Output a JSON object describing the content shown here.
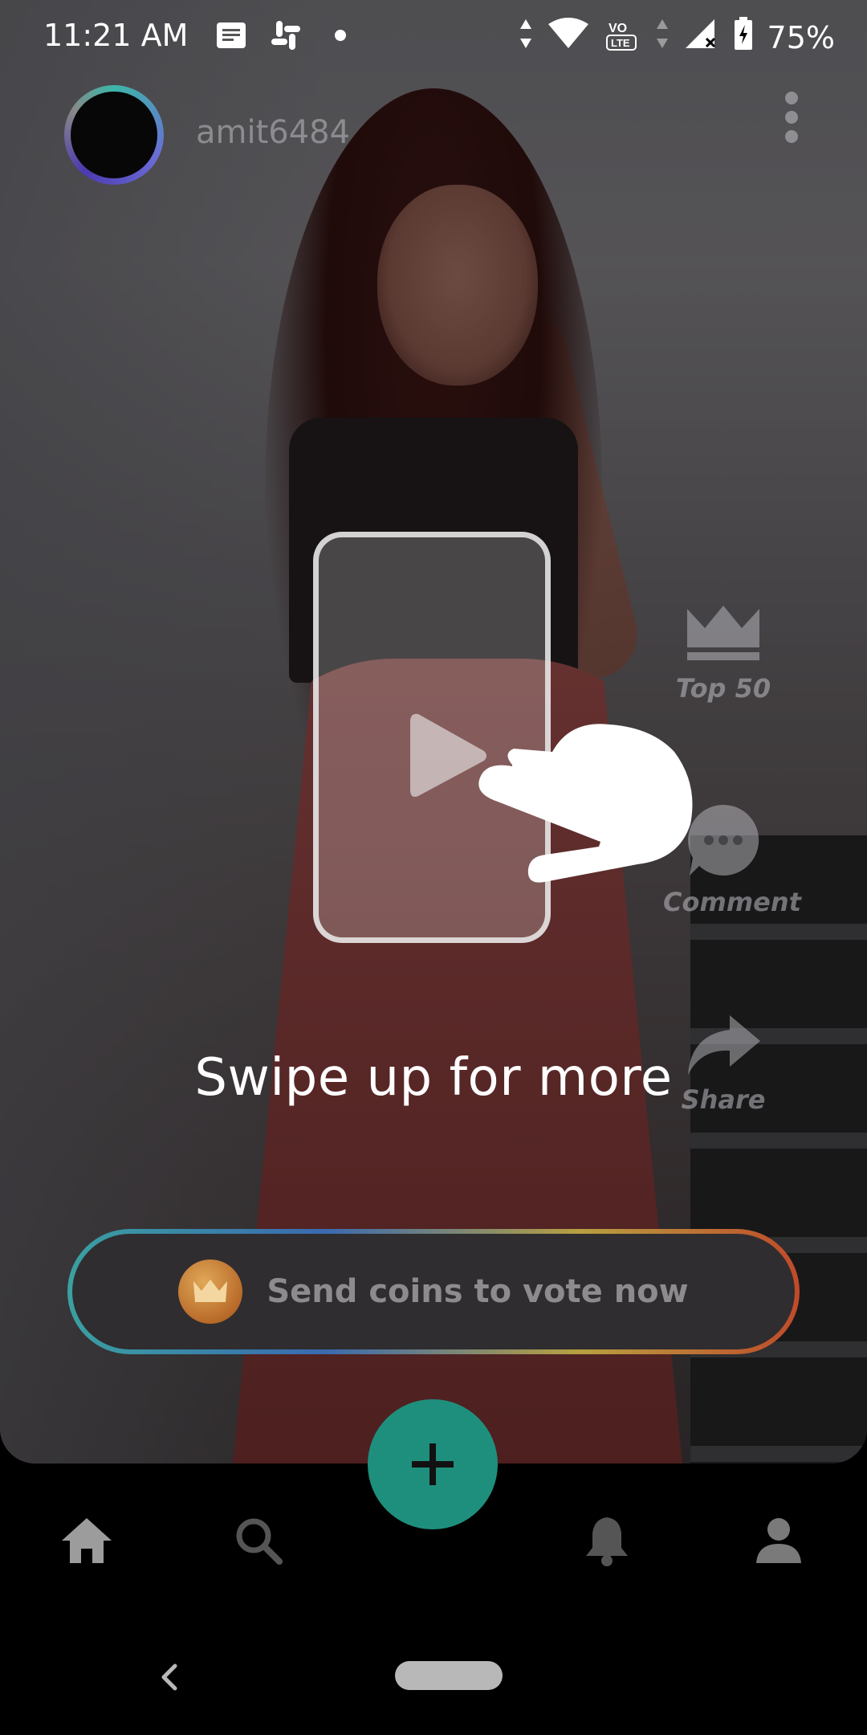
{
  "status_bar": {
    "time": "11:21 AM",
    "battery": "75%",
    "notification_icons": [
      "message-icon",
      "slack-icon",
      "dot-icon"
    ],
    "status_icons": [
      "data-arrows-icon",
      "wifi-icon",
      "volte-icon",
      "signal-icon",
      "battery-icon"
    ]
  },
  "header": {
    "username": "amit6484"
  },
  "side_actions": {
    "top50_label": "Top 50",
    "comment_label": "Comment",
    "share_label": "Share"
  },
  "tutorial": {
    "text": "Swipe up for more"
  },
  "vote": {
    "label": "Send coins to vote now"
  },
  "bottom_nav": {
    "items": [
      "home-icon",
      "search-icon",
      "bell-icon",
      "profile-icon"
    ]
  },
  "colors": {
    "fab": "#1f8f7d",
    "accent_ring": "#3cb6a8"
  }
}
